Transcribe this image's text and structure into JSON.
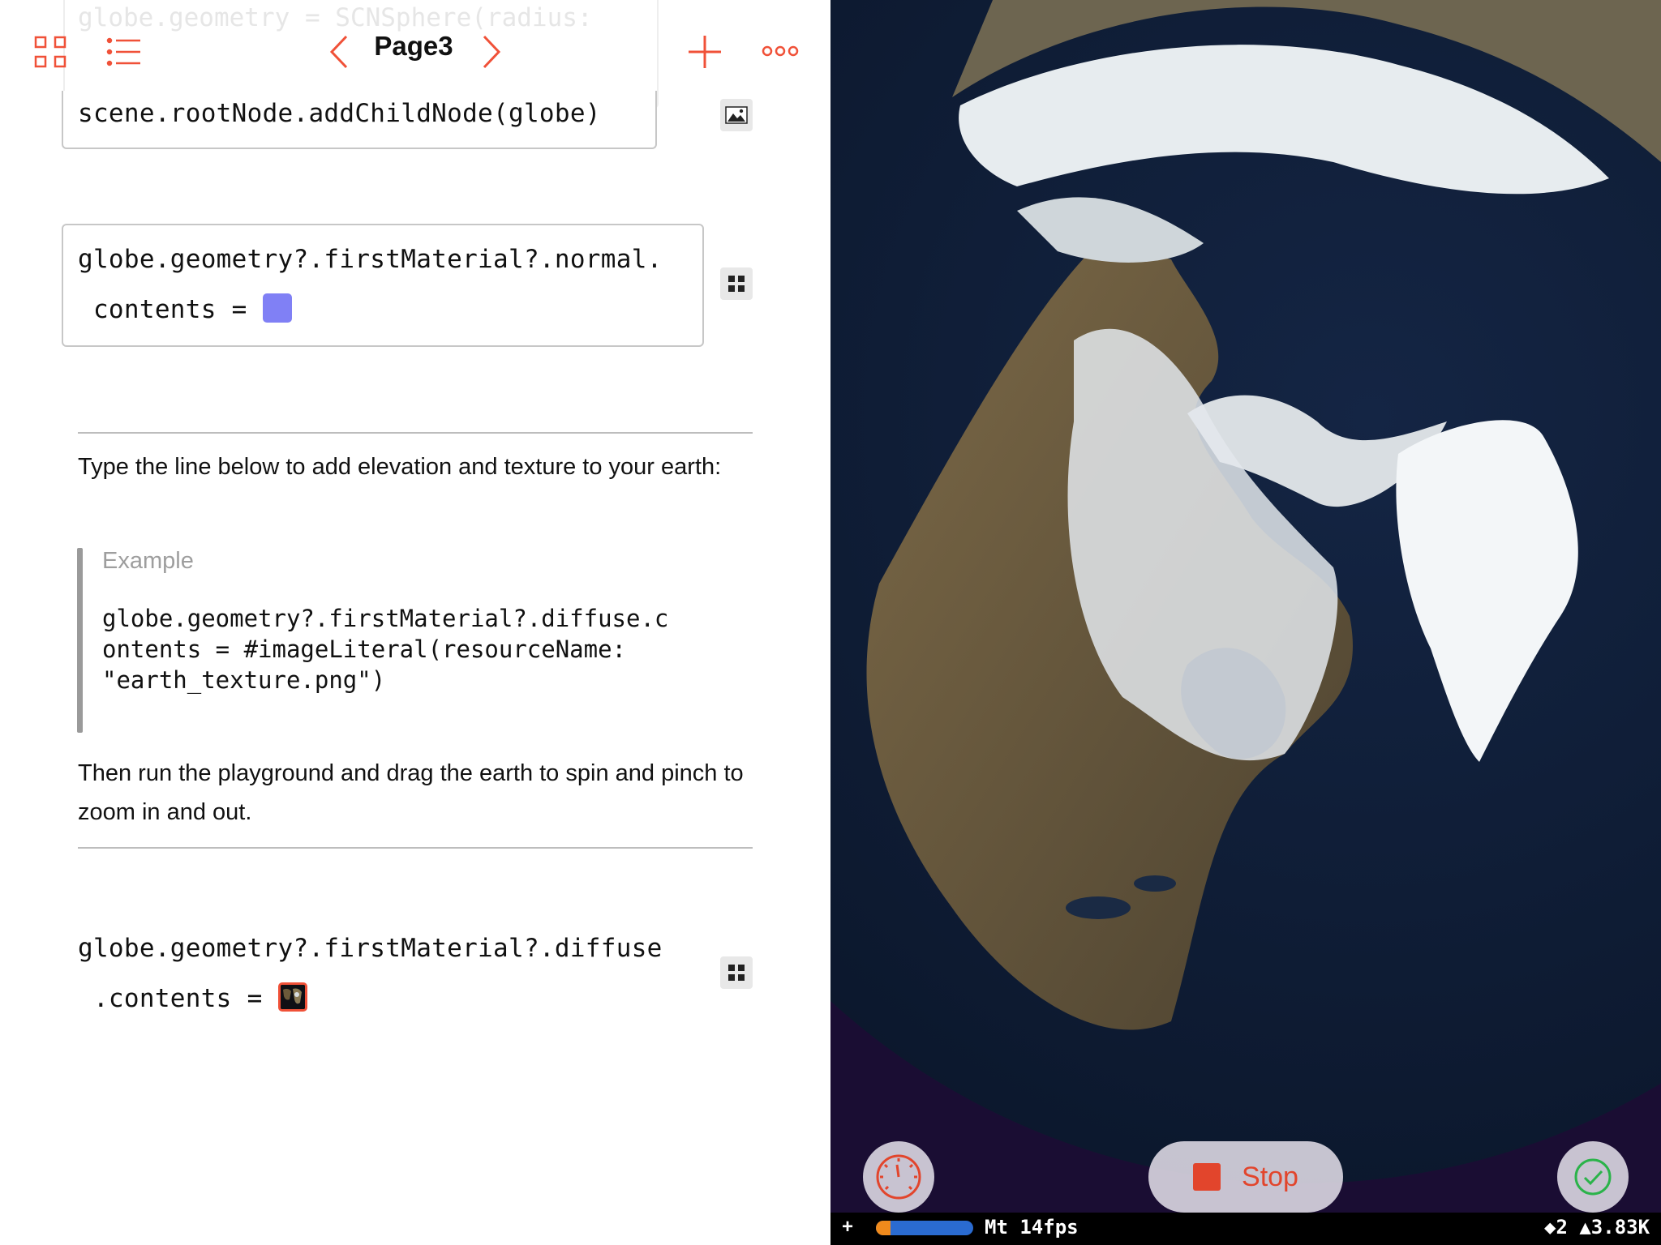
{
  "toolbar": {
    "page_title": "Page3",
    "icons": [
      "grid-icon",
      "list-icon",
      "chevron-left-icon",
      "chevron-right-icon",
      "plus-icon",
      "more-icon"
    ]
  },
  "editor": {
    "ghost_line": "globe.geometry = SCNSphere(radius:",
    "code_root": "scene.rootNode.addChildNode(globe)",
    "normal_line1": "globe.geometry?.firstMaterial?.normal.",
    "normal_line2": " contents = ",
    "normal_color": "#8080f5",
    "instruction": "Type the line below to add elevation and texture to your earth:",
    "example_label": "Example",
    "example_lines": [
      "globe.geometry?.firstMaterial?.diffuse.c",
      "ontents = #imageLiteral(resourceName:",
      "\"earth_texture.png\")"
    ],
    "run_text": "Then run the playground and drag the earth to spin and pinch to zoom in and out.",
    "diffuse_line1": "globe.geometry?.firstMaterial?.diffuse",
    "diffuse_line2": " .contents = "
  },
  "liveview": {
    "stop_label": "Stop",
    "status": {
      "plus": "+",
      "progress": 0.15,
      "fps": "Mt 14fps",
      "stats": "◆2 ▲3.83K"
    }
  },
  "colors": {
    "accent": "#f05138",
    "space": "#1a0d33",
    "ocean": "#0d1a33",
    "ice": "#e8eef2",
    "land": "#6f5a3c"
  }
}
